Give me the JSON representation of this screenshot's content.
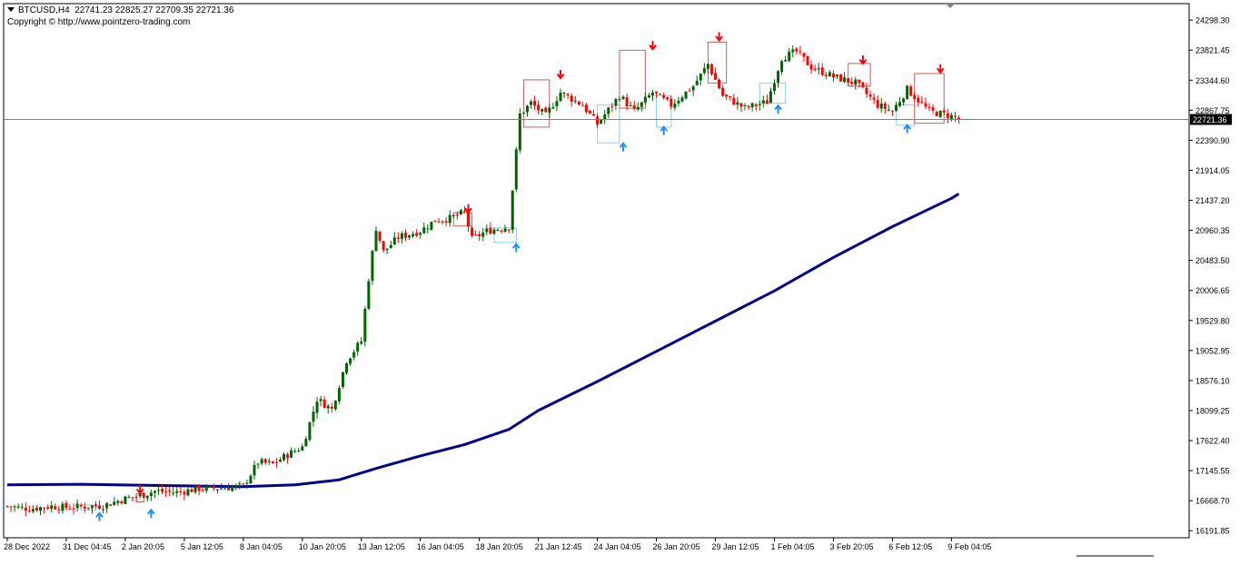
{
  "header": {
    "symbol": "BTCUSD,H4",
    "ohlc": "22741.23 22825.27 22709.35 22721.36",
    "copyright": "Copyright © http://www.pointzero-trading.com"
  },
  "colors": {
    "bull": "#006400",
    "bear": "#ff0000",
    "ma": "#00008b",
    "price_line": "#808080",
    "frame": "#000000",
    "signal_up": "#1e90ff",
    "signal_down": "#ff0000",
    "zone_up": "#87ceeb",
    "zone_down": "#cd5c5c"
  },
  "chart_data": {
    "type": "candlestick",
    "symbol": "BTCUSD",
    "timeframe": "H4",
    "ylim": [
      16080,
      24560
    ],
    "y_ticks": [
      "24298.30",
      "23821.45",
      "23344.60",
      "22867.75",
      "22390.90",
      "21914.05",
      "21437.20",
      "20960.35",
      "20483.50",
      "20006.65",
      "19529.80",
      "19052.95",
      "18576.10",
      "18099.25",
      "17622.40",
      "17145.55",
      "16668.70",
      "16191.85"
    ],
    "y_tick_values": [
      24298.3,
      23821.45,
      23344.6,
      22867.75,
      22390.9,
      21914.05,
      21437.2,
      20960.35,
      20483.5,
      20006.65,
      19529.8,
      19052.95,
      18576.1,
      18099.25,
      17622.4,
      17145.55,
      16668.7,
      16191.85
    ],
    "x_ticks": [
      "28 Dec 2022",
      "31 Dec 04:45",
      "2 Jan 20:05",
      "5 Jan 12:05",
      "8 Jan 04:05",
      "10 Jan 20:05",
      "13 Jan 12:05",
      "16 Jan 04:05",
      "18 Jan 20:05",
      "21 Jan 12:45",
      "24 Jan 04:05",
      "26 Jan 20:05",
      "29 Jan 12:05",
      "1 Feb 04:05",
      "3 Feb 20:05",
      "6 Feb 12:05",
      "9 Feb 04:05"
    ],
    "x_tick_bar_index": [
      0,
      16,
      32,
      48,
      64,
      80,
      96,
      112,
      128,
      144,
      160,
      176,
      192,
      208,
      224,
      240,
      256
    ],
    "current_price": "22721.36",
    "current_price_value": 22721.36,
    "close_anchors": [
      [
        0,
        16580
      ],
      [
        6,
        16540
      ],
      [
        12,
        16580
      ],
      [
        16,
        16560
      ],
      [
        22,
        16580
      ],
      [
        26,
        16590
      ],
      [
        32,
        16700
      ],
      [
        36,
        16750
      ],
      [
        40,
        16820
      ],
      [
        46,
        16800
      ],
      [
        52,
        16860
      ],
      [
        58,
        16870
      ],
      [
        64,
        16900
      ],
      [
        68,
        17280
      ],
      [
        72,
        17250
      ],
      [
        76,
        17400
      ],
      [
        80,
        17520
      ],
      [
        84,
        18280
      ],
      [
        88,
        18120
      ],
      [
        92,
        18900
      ],
      [
        96,
        19200
      ],
      [
        98,
        20200
      ],
      [
        100,
        21000
      ],
      [
        102,
        20620
      ],
      [
        106,
        20850
      ],
      [
        112,
        20950
      ],
      [
        116,
        21120
      ],
      [
        120,
        21150
      ],
      [
        124,
        21250
      ],
      [
        126,
        20820
      ],
      [
        130,
        20950
      ],
      [
        136,
        21020
      ],
      [
        139,
        22800
      ],
      [
        142,
        22980
      ],
      [
        146,
        22780
      ],
      [
        150,
        23150
      ],
      [
        156,
        22950
      ],
      [
        160,
        22650
      ],
      [
        166,
        23100
      ],
      [
        170,
        22850
      ],
      [
        175,
        23150
      ],
      [
        180,
        22950
      ],
      [
        186,
        23250
      ],
      [
        190,
        23600
      ],
      [
        194,
        23100
      ],
      [
        200,
        22900
      ],
      [
        206,
        23000
      ],
      [
        210,
        23700
      ],
      [
        214,
        23800
      ],
      [
        218,
        23550
      ],
      [
        224,
        23400
      ],
      [
        230,
        23300
      ],
      [
        236,
        22950
      ],
      [
        240,
        22850
      ],
      [
        244,
        23200
      ],
      [
        250,
        22850
      ],
      [
        254,
        22800
      ],
      [
        258,
        22740
      ]
    ],
    "ma_points": [
      [
        0,
        16920
      ],
      [
        20,
        16930
      ],
      [
        40,
        16910
      ],
      [
        64,
        16890
      ],
      [
        78,
        16920
      ],
      [
        90,
        17000
      ],
      [
        100,
        17180
      ],
      [
        112,
        17380
      ],
      [
        124,
        17560
      ],
      [
        136,
        17800
      ],
      [
        144,
        18100
      ],
      [
        160,
        18560
      ],
      [
        176,
        19040
      ],
      [
        192,
        19520
      ],
      [
        208,
        20000
      ],
      [
        224,
        20530
      ],
      [
        240,
        21020
      ],
      [
        256,
        21470
      ],
      [
        258,
        21540
      ]
    ],
    "zones": [
      {
        "kind": "down",
        "bars": [
          140,
          147
        ],
        "range": [
          22600,
          23350
        ]
      },
      {
        "kind": "up",
        "bars": [
          160,
          166
        ],
        "range": [
          22350,
          22950
        ]
      },
      {
        "kind": "down",
        "bars": [
          166,
          173
        ],
        "range": [
          22900,
          23820
        ]
      },
      {
        "kind": "up",
        "bars": [
          176,
          180
        ],
        "range": [
          22600,
          23100
        ]
      },
      {
        "kind": "down",
        "bars": [
          190,
          195
        ],
        "range": [
          23300,
          23950
        ]
      },
      {
        "kind": "up",
        "bars": [
          204,
          211
        ],
        "range": [
          22980,
          23300
        ]
      },
      {
        "kind": "down",
        "bars": [
          228,
          234
        ],
        "range": [
          23250,
          23610
        ]
      },
      {
        "kind": "up",
        "bars": [
          241,
          246
        ],
        "range": [
          22630,
          22950
        ]
      },
      {
        "kind": "down",
        "bars": [
          246,
          254
        ],
        "range": [
          22660,
          23450
        ]
      },
      {
        "kind": "down",
        "bars": [
          121,
          126
        ],
        "range": [
          21030,
          21240
        ]
      },
      {
        "kind": "up",
        "bars": [
          132,
          138
        ],
        "range": [
          20770,
          21000
        ]
      },
      {
        "kind": "down",
        "bars": [
          35,
          37
        ],
        "range": [
          16650,
          16780
        ]
      },
      {
        "kind": "up",
        "bars": [
          20,
          24
        ],
        "range": [
          16520,
          16600
        ]
      }
    ],
    "signals": [
      {
        "kind": "up",
        "bar": 25,
        "price": 16430
      },
      {
        "kind": "up",
        "bar": 39,
        "price": 16480
      },
      {
        "kind": "down",
        "bar": 36,
        "price": 16830
      },
      {
        "kind": "down",
        "bar": 125,
        "price": 21290
      },
      {
        "kind": "up",
        "bar": 138,
        "price": 20700
      },
      {
        "kind": "down",
        "bar": 150,
        "price": 23420
      },
      {
        "kind": "up",
        "bar": 167,
        "price": 22300
      },
      {
        "kind": "down",
        "bar": 175,
        "price": 23880
      },
      {
        "kind": "up",
        "bar": 178,
        "price": 22560
      },
      {
        "kind": "down",
        "bar": 193,
        "price": 24020
      },
      {
        "kind": "up",
        "bar": 209,
        "price": 22900
      },
      {
        "kind": "down",
        "bar": 232,
        "price": 23650
      },
      {
        "kind": "up",
        "bar": 244,
        "price": 22590
      },
      {
        "kind": "down",
        "bar": 253,
        "price": 23510
      }
    ]
  }
}
